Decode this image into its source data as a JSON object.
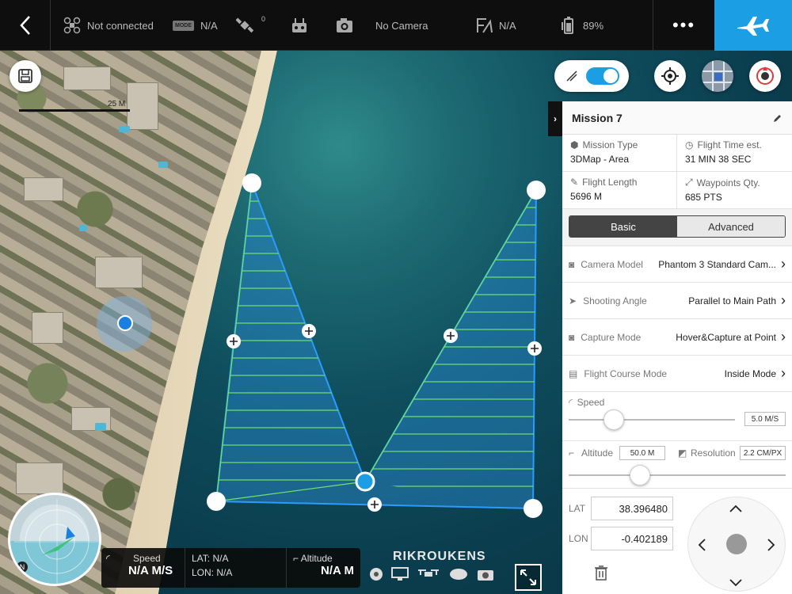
{
  "topbar": {
    "connection": "Not connected",
    "mode_badge": "MODE",
    "mode_value": "N/A",
    "gps_count": "0",
    "camera": "No Camera",
    "flight_mode": "N/A",
    "battery": "89%",
    "more": "•••"
  },
  "map": {
    "scale_label": "25 M",
    "watermark": "RIKROUKENS"
  },
  "mission": {
    "title": "Mission 7",
    "stats": [
      {
        "label": "Mission Type",
        "value": "3DMap - Area"
      },
      {
        "label": "Flight Time est.",
        "value": "31 MIN 38 SEC"
      },
      {
        "label": "Flight Length",
        "value": "5696 M"
      },
      {
        "label": "Waypoints Qty.",
        "value": "685 PTS"
      }
    ],
    "tabs": {
      "basic": "Basic",
      "advanced": "Advanced"
    },
    "settings": [
      {
        "label": "Camera Model",
        "value": "Phantom 3 Standard Cam..."
      },
      {
        "label": "Shooting Angle",
        "value": "Parallel to Main Path"
      },
      {
        "label": "Capture Mode",
        "value": "Hover&Capture at Point"
      },
      {
        "label": "Flight Course Mode",
        "value": "Inside Mode"
      }
    ],
    "speed": {
      "label": "Speed",
      "value": "5.0 M/S",
      "level": 0.27
    },
    "altitude": {
      "label": "Altitude",
      "value": "50.0 M",
      "level": 0.33
    },
    "resolution": {
      "label": "Resolution",
      "value": "2.2 CM/PX"
    },
    "lat": {
      "label": "LAT",
      "value": "38.396480"
    },
    "lon": {
      "label": "LON",
      "value": "-0.402189"
    }
  },
  "hud": {
    "speed_label": "Speed",
    "speed_value": "N/A M/S",
    "lat": "LAT: N/A",
    "lon": "LON: N/A",
    "altitude_label": "Altitude",
    "altitude_value": "N/A M"
  },
  "compass": {
    "north": "N"
  },
  "colors": {
    "accent": "#1b9ee3",
    "survey_fill": "#2a8fd6",
    "survey_lines": "#6fe06a"
  }
}
